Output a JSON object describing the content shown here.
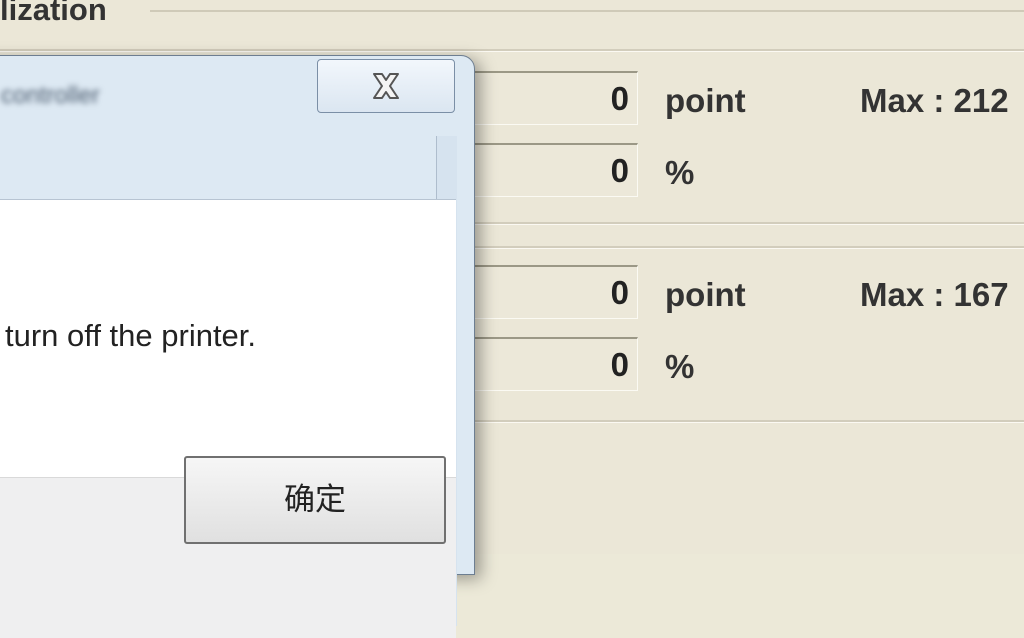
{
  "groupbox": {
    "title": "lization"
  },
  "rows": [
    {
      "value": "0",
      "unit": "point",
      "max": "Max : 212"
    },
    {
      "value": "0",
      "unit": "%"
    },
    {
      "value": "0",
      "unit": "point",
      "max": "Max : 167"
    },
    {
      "value": "0",
      "unit": "%"
    }
  ],
  "dialog": {
    "title": "controller",
    "message": "turn off the printer.",
    "ok_label": "确定",
    "close_icon": "close-icon"
  }
}
